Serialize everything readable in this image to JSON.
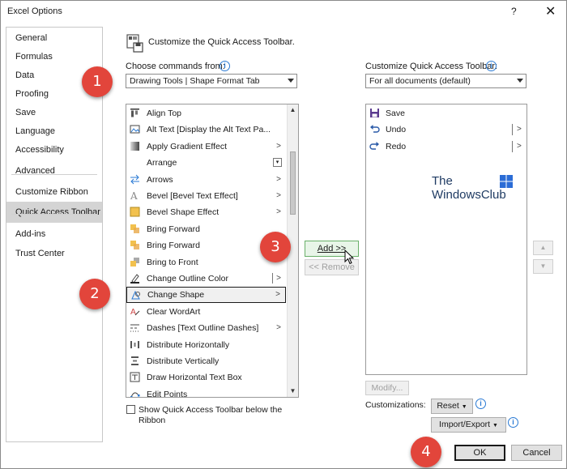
{
  "window": {
    "title": "Excel Options",
    "help": "?",
    "close": "✕"
  },
  "nav": {
    "items": [
      {
        "label": "General",
        "selected": false
      },
      {
        "label": "Formulas",
        "selected": false
      },
      {
        "label": "Data",
        "selected": false
      },
      {
        "label": "Proofing",
        "selected": false
      },
      {
        "label": "Save",
        "selected": false
      },
      {
        "label": "Language",
        "selected": false
      },
      {
        "label": "Accessibility",
        "selected": false
      },
      {
        "label": "Advanced",
        "selected": false
      },
      {
        "label": "Customize Ribbon",
        "selected": false
      },
      {
        "label": "Quick Access Toolbar",
        "selected": true
      },
      {
        "label": "Add-ins",
        "selected": false
      },
      {
        "label": "Trust Center",
        "selected": false
      }
    ]
  },
  "header": {
    "title": "Customize the Quick Access Toolbar."
  },
  "commands": {
    "label": "Choose commands from:",
    "selected": "Drawing Tools | Shape Format Tab",
    "items": [
      {
        "label": "Align Top",
        "icon": "align-top-icon",
        "suffix": "none"
      },
      {
        "label": "Alt Text [Display the Alt Text Pa...",
        "icon": "alt-text-icon",
        "suffix": "none"
      },
      {
        "label": "Apply Gradient Effect",
        "icon": "gradient-icon",
        "suffix": "arrow"
      },
      {
        "label": "Arrange",
        "icon": "none",
        "suffix": "combo"
      },
      {
        "label": "Arrows",
        "icon": "arrows-icon",
        "suffix": "arrow"
      },
      {
        "label": "Bevel [Bevel Text Effect]",
        "icon": "bevel-text-icon",
        "suffix": "arrow"
      },
      {
        "label": "Bevel Shape Effect",
        "icon": "bevel-shape-icon",
        "suffix": "arrow"
      },
      {
        "label": "Bring Forward",
        "icon": "bring-forward-icon",
        "suffix": "none"
      },
      {
        "label": "Bring Forward",
        "icon": "bring-forward-icon",
        "suffix": "none"
      },
      {
        "label": "Bring to Front",
        "icon": "bring-to-front-icon",
        "suffix": "none"
      },
      {
        "label": "Change Outline Color",
        "icon": "outline-color-icon",
        "suffix": "split"
      },
      {
        "label": "Change Shape",
        "icon": "change-shape-icon",
        "suffix": "arrow",
        "selected": true
      },
      {
        "label": "Clear WordArt",
        "icon": "clear-wordart-icon",
        "suffix": "none"
      },
      {
        "label": "Dashes [Text Outline Dashes]",
        "icon": "dashes-icon",
        "suffix": "arrow"
      },
      {
        "label": "Distribute Horizontally",
        "icon": "distribute-h-icon",
        "suffix": "none"
      },
      {
        "label": "Distribute Vertically",
        "icon": "distribute-v-icon",
        "suffix": "none"
      },
      {
        "label": "Draw Horizontal Text Box",
        "icon": "text-box-icon",
        "suffix": "none"
      },
      {
        "label": "Edit Points",
        "icon": "edit-points-icon",
        "suffix": "none"
      }
    ]
  },
  "buttons": {
    "add": "Add >>",
    "remove": "<< Remove"
  },
  "qat": {
    "label": "Customize Quick Access Toolbar:",
    "selected": "For all documents (default)",
    "items": [
      {
        "label": "Save",
        "icon": "save-icon",
        "split": false
      },
      {
        "label": "Undo",
        "icon": "undo-icon",
        "split": true
      },
      {
        "label": "Redo",
        "icon": "redo-icon",
        "split": true
      }
    ]
  },
  "watermark": {
    "line1": "The",
    "line2": "WindowsClub"
  },
  "modify": "Modify...",
  "customizations": {
    "label": "Customizations:",
    "reset": "Reset",
    "import_export": "Import/Export"
  },
  "checkbox": {
    "label": "Show Quick Access Toolbar below the Ribbon",
    "checked": false
  },
  "footer": {
    "ok": "OK",
    "cancel": "Cancel"
  },
  "steps": [
    "1",
    "2",
    "3",
    "4"
  ],
  "colors": {
    "accent": "#e2453b",
    "info": "#2a7ad4"
  }
}
